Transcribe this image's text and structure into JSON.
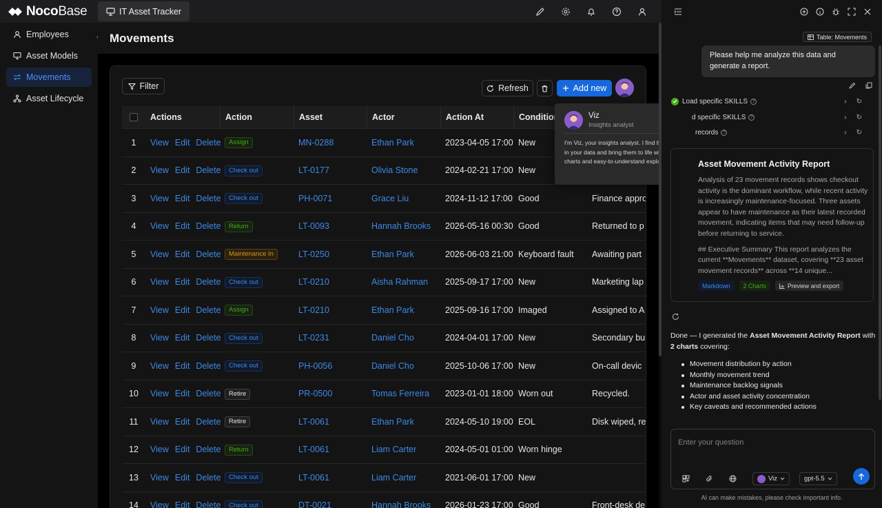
{
  "header": {
    "logo_text_bold": "Noco",
    "logo_text_thin": "Base",
    "app_tab": "IT Asset Tracker"
  },
  "sidebar": {
    "items": [
      {
        "label": "Employees",
        "icon": "user-icon",
        "active": false
      },
      {
        "label": "Asset Models",
        "icon": "monitor-icon",
        "active": false
      },
      {
        "label": "Movements",
        "icon": "swap-icon",
        "active": true
      },
      {
        "label": "Asset Lifecycle",
        "icon": "branch-icon",
        "active": false
      }
    ]
  },
  "page": {
    "title": "Movements",
    "filter_label": "Filter",
    "refresh_label": "Refresh",
    "add_new_label": "Add new"
  },
  "table": {
    "columns": [
      "Actions",
      "Action",
      "Asset",
      "Actor",
      "Action At",
      "Condition N"
    ],
    "row_actions": [
      "View",
      "Edit",
      "Delete"
    ],
    "rows": [
      {
        "num": "1",
        "action": "Assign",
        "tag": "green",
        "asset": "MN-0288",
        "actor": "Ethan Park",
        "at": "2023-04-05 17:00:0",
        "condition": "New",
        "notes": ""
      },
      {
        "num": "2",
        "action": "Check out",
        "tag": "blue",
        "asset": "LT-0177",
        "actor": "Olivia Stone",
        "at": "2024-02-21 17:00:00",
        "condition": "New",
        "notes": ""
      },
      {
        "num": "3",
        "action": "Check out",
        "tag": "blue",
        "asset": "PH-0071",
        "actor": "Grace Liu",
        "at": "2024-11-12 17:00:00",
        "condition": "Good",
        "notes": "Finance appro"
      },
      {
        "num": "4",
        "action": "Return",
        "tag": "green",
        "asset": "LT-0093",
        "actor": "Hannah Brooks",
        "at": "2026-05-16 00:30:0",
        "condition": "Good",
        "notes": "Returned to p"
      },
      {
        "num": "5",
        "action": "Maintenance In",
        "tag": "gold",
        "asset": "LT-0250",
        "actor": "Ethan Park",
        "at": "2026-06-03 21:00:0",
        "condition": "Keyboard fault",
        "notes": "Awaiting part"
      },
      {
        "num": "6",
        "action": "Check out",
        "tag": "blue",
        "asset": "LT-0210",
        "actor": "Aisha Rahman",
        "at": "2025-09-17 17:00:0",
        "condition": "New",
        "notes": "Marketing lap"
      },
      {
        "num": "7",
        "action": "Assign",
        "tag": "green",
        "asset": "LT-0210",
        "actor": "Ethan Park",
        "at": "2025-09-16 17:00:0",
        "condition": "Imaged",
        "notes": "Assigned to A"
      },
      {
        "num": "8",
        "action": "Check out",
        "tag": "blue",
        "asset": "LT-0231",
        "actor": "Daniel Cho",
        "at": "2024-04-01 17:00:0",
        "condition": "New",
        "notes": "Secondary bu"
      },
      {
        "num": "9",
        "action": "Check out",
        "tag": "blue",
        "asset": "PH-0056",
        "actor": "Daniel Cho",
        "at": "2025-10-06 17:00:0",
        "condition": "New",
        "notes": "On-call devic"
      },
      {
        "num": "10",
        "action": "Retire",
        "tag": "gray",
        "asset": "PR-0500",
        "actor": "Tomas Ferreira",
        "at": "2023-01-01 18:00:0",
        "condition": "Worn out",
        "notes": "Recycled."
      },
      {
        "num": "11",
        "action": "Retire",
        "tag": "gray",
        "asset": "LT-0061",
        "actor": "Ethan Park",
        "at": "2024-05-10 19:00:0",
        "condition": "EOL",
        "notes": "Disk wiped, re"
      },
      {
        "num": "12",
        "action": "Return",
        "tag": "green",
        "asset": "LT-0061",
        "actor": "Liam Carter",
        "at": "2024-05-01 01:00:0",
        "condition": "Worn hinge",
        "notes": ""
      },
      {
        "num": "13",
        "action": "Check out",
        "tag": "blue",
        "asset": "LT-0061",
        "actor": "Liam Carter",
        "at": "2021-06-01 17:00:0",
        "condition": "New",
        "notes": ""
      },
      {
        "num": "14",
        "action": "Check out",
        "tag": "blue",
        "asset": "DT-0021",
        "actor": "Hannah Brooks",
        "at": "2026-01-23 17:00:0",
        "condition": "Good",
        "notes": "Front-desk de"
      }
    ]
  },
  "tooltip": {
    "name": "Viz",
    "role": "Insights analyst",
    "description": "I'm Viz, your insights analyst. I find the stories in your data and bring them to life with clear charts and easy-to-understand explanations."
  },
  "assistant": {
    "context_chip": "Table: Movements",
    "user_message": "Please help me analyze this data and generate a report.",
    "skills": [
      {
        "label": "Load specific SKILLS",
        "done": true
      },
      {
        "label": "d specific SKILLS",
        "done": false
      },
      {
        "label": "records",
        "done": false
      }
    ],
    "report": {
      "title": "Asset Movement Activity Report",
      "para1": "Analysis of 23 movement records shows checkout activity is the dominant workflow, while recent activity is increasingly maintenance-focused. Three assets appear to have maintenance as their latest recorded movement, indicating items that may need follow-up before returning to service.",
      "para2": "## Executive Summary This report analyzes the current **Movements** dataset, covering **23 asset movement records** across **14 unique...",
      "tag_markdown": "Markdown",
      "tag_charts": "2 Charts",
      "tag_preview": "Preview and export"
    },
    "done_prefix": "Done — I generated the ",
    "done_report": "Asset Movement Activity Report",
    "done_mid": " with ",
    "done_charts": "2 charts",
    "done_suffix": " covering:",
    "bullets": [
      "Movement distribution by action",
      "Monthly movement trend",
      "Maintenance backlog signals",
      "Actor and asset activity concentration",
      "Key caveats and recommended actions"
    ],
    "input_placeholder": "Enter your question",
    "persona": "Viz",
    "model": "gpt-5.5",
    "disclaimer": "AI can make mistakes, please check important info."
  }
}
